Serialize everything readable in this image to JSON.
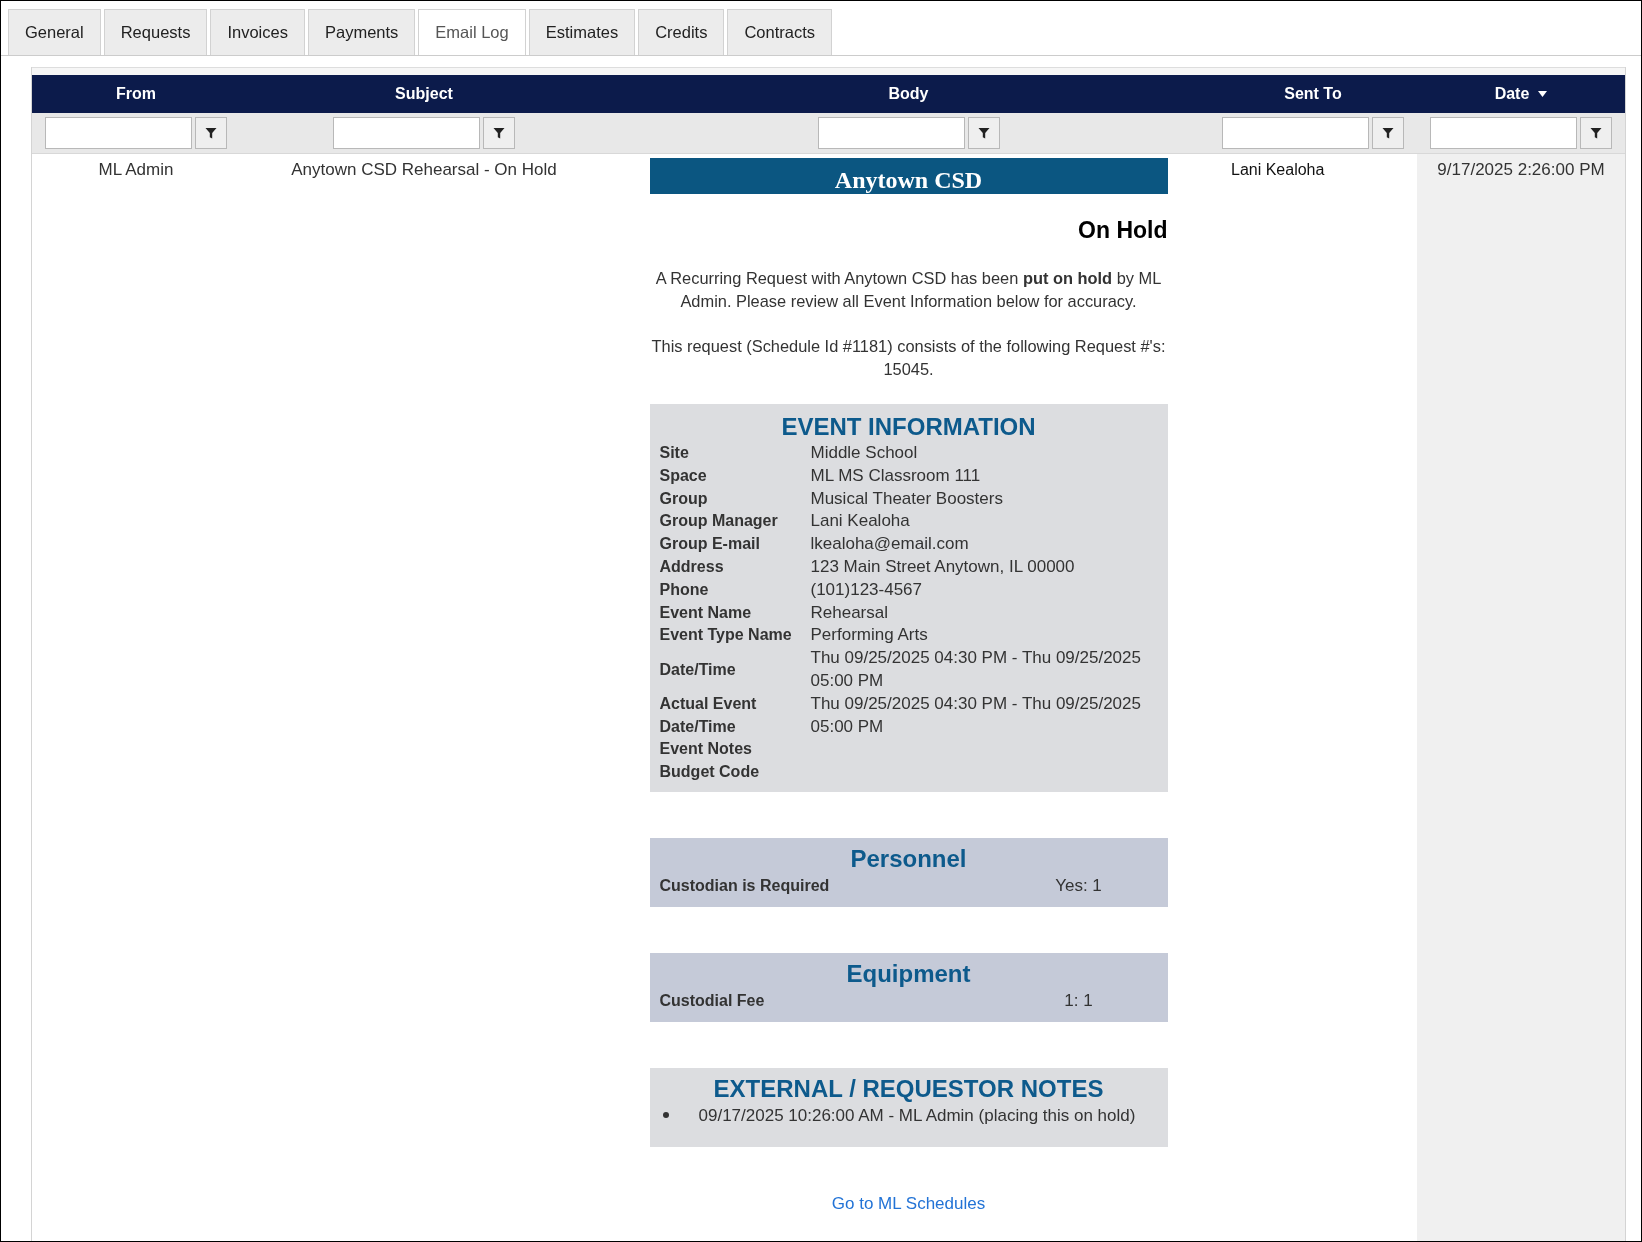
{
  "tabs": [
    {
      "label": "General",
      "selected": false
    },
    {
      "label": "Requests",
      "selected": false
    },
    {
      "label": "Invoices",
      "selected": false
    },
    {
      "label": "Payments",
      "selected": false
    },
    {
      "label": "Email Log",
      "selected": true
    },
    {
      "label": "Estimates",
      "selected": false
    },
    {
      "label": "Credits",
      "selected": false
    },
    {
      "label": "Contracts",
      "selected": false
    }
  ],
  "grid": {
    "columns": [
      {
        "label": "From",
        "sorted": false
      },
      {
        "label": "Subject",
        "sorted": false
      },
      {
        "label": "Body",
        "sorted": false
      },
      {
        "label": "Sent To",
        "sorted": false
      },
      {
        "label": "Date",
        "sorted": true
      }
    ],
    "rows": [
      {
        "from": "ML Admin",
        "subject": "Anytown CSD Rehearsal - On Hold",
        "body": {
          "banner": "Anytown CSD",
          "status": "On Hold",
          "paragraphs": [
            "A Recurring Request with Anytown CSD has been **put on hold** by ML Admin. Please review all Event Information below for accuracy.",
            "This request (Schedule Id #1181) consists of the following Request #'s: 15045."
          ],
          "sections": [
            {
              "kind": "details",
              "title": "EVENT INFORMATION",
              "rows": [
                {
                  "label": "Site",
                  "value": "Middle School"
                },
                {
                  "label": "Space",
                  "value": "ML MS Classroom 111"
                },
                {
                  "label": "Group",
                  "value": "Musical Theater Boosters"
                },
                {
                  "label": "Group Manager",
                  "value": "Lani Kealoha"
                },
                {
                  "label": "Group E-mail",
                  "value": "lkealoha@email.com"
                },
                {
                  "label": "Address",
                  "value": "123 Main Street Anytown, IL 00000"
                },
                {
                  "label": "Phone",
                  "value": "(101)123-4567"
                },
                {
                  "label": "Event Name",
                  "value": "Rehearsal"
                },
                {
                  "label": "Event Type Name",
                  "value": "Performing Arts"
                },
                {
                  "label": "Date/Time",
                  "value": "Thu 09/25/2025 04:30 PM - Thu 09/25/2025 05:00 PM"
                },
                {
                  "label": "Actual Event Date/Time",
                  "value": "Thu 09/25/2025 04:30 PM - Thu 09/25/2025 05:00 PM"
                },
                {
                  "label": "Event Notes"
                },
                {
                  "label": "Budget Code"
                }
              ]
            },
            {
              "kind": "items",
              "title": "Personnel",
              "rows": [
                {
                  "label": "Custodian is Required",
                  "value": "Yes: 1"
                }
              ]
            },
            {
              "kind": "items",
              "title": "Equipment",
              "rows": [
                {
                  "label": "Custodial Fee",
                  "value": "1: 1"
                }
              ]
            },
            {
              "kind": "notes",
              "title": "EXTERNAL / REQUESTOR NOTES",
              "items": [
                "09/17/2025 10:26:00 AM - ML Admin (placing this on hold)"
              ]
            }
          ],
          "link": "Go to ML Schedules"
        },
        "sent_to": "Lani Kealoha",
        "date": "9/17/2025 2:26:00 PM"
      }
    ]
  }
}
